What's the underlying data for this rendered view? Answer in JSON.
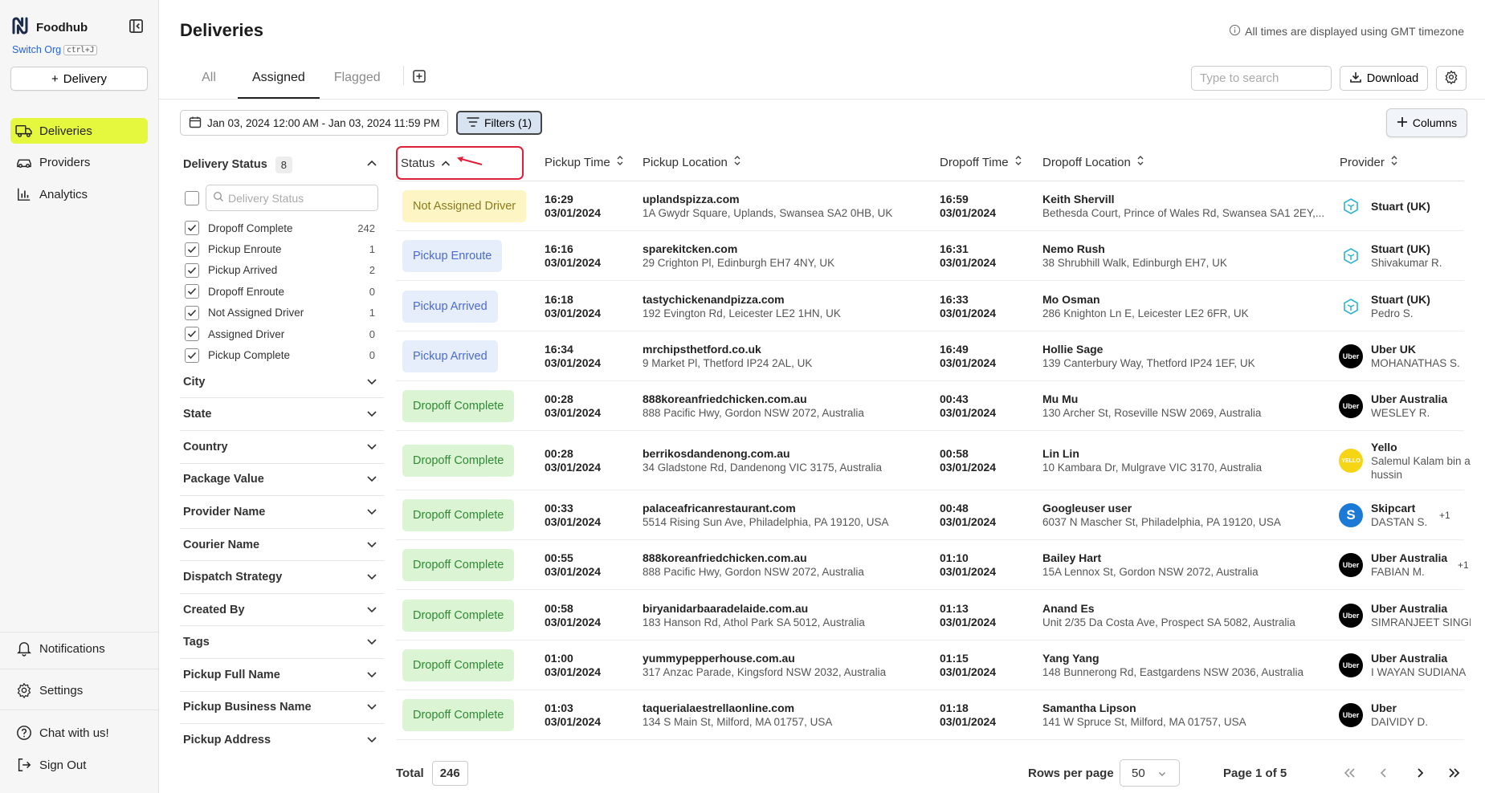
{
  "sidebar": {
    "brand": "Foodhub",
    "switch_org": "Switch Org",
    "switch_org_kbd": "ctrl+J",
    "add_delivery": "Delivery",
    "nav": [
      {
        "label": "Deliveries",
        "icon": "truck-icon",
        "active": true
      },
      {
        "label": "Providers",
        "icon": "car-icon"
      },
      {
        "label": "Analytics",
        "icon": "bar-chart-icon"
      }
    ],
    "bottom": [
      {
        "label": "Notifications",
        "icon": "bell-icon"
      },
      {
        "label": "Settings",
        "icon": "gear-icon"
      },
      {
        "label": "Chat with us!",
        "icon": "help-circle-icon"
      },
      {
        "label": "Sign Out",
        "icon": "sign-out-icon"
      }
    ]
  },
  "header": {
    "title": "Deliveries",
    "tz_note": "All times are displayed using GMT timezone",
    "tabs": [
      {
        "label": "All"
      },
      {
        "label": "Assigned",
        "active": true
      },
      {
        "label": "Flagged"
      }
    ],
    "search_placeholder": "Type to search",
    "download": "Download"
  },
  "toolbar": {
    "date_range": "Jan 03, 2024 12:00 AM - Jan 03, 2024 11:59 PM",
    "filters": "Filters (1)",
    "columns": "Columns"
  },
  "filters": {
    "delivery_status": {
      "title": "Delivery Status",
      "count": "8",
      "search_placeholder": "Delivery Status",
      "options": [
        {
          "label": "Dropoff Complete",
          "count": "242"
        },
        {
          "label": "Pickup Enroute",
          "count": "1"
        },
        {
          "label": "Pickup Arrived",
          "count": "2"
        },
        {
          "label": "Dropoff Enroute",
          "count": "0"
        },
        {
          "label": "Not Assigned Driver",
          "count": "1"
        },
        {
          "label": "Assigned Driver",
          "count": "0"
        },
        {
          "label": "Pickup Complete",
          "count": "0"
        }
      ]
    },
    "sections": [
      "City",
      "State",
      "Country",
      "Package Value",
      "Provider Name",
      "Courier Name",
      "Dispatch Strategy",
      "Created By",
      "Tags",
      "Pickup Full Name",
      "Pickup Business Name",
      "Pickup Address"
    ]
  },
  "table": {
    "columns": [
      "Status",
      "Pickup Time",
      "Pickup Location",
      "Dropoff Time",
      "Dropoff Location",
      "Provider"
    ],
    "rows": [
      {
        "status": "Not Assigned Driver",
        "kind": "nad",
        "pickup_time": "16:29",
        "pickup_date": "03/01/2024",
        "pickup_name": "uplandspizza.com",
        "pickup_addr": "1A Gwydr Square, Uplands, Swansea SA2 0HB, UK",
        "dropoff_time": "16:59",
        "dropoff_date": "03/01/2024",
        "dropoff_name": "Keith Shervill",
        "dropoff_addr": "Bethesda Court, Prince of Wales Rd, Swansea SA1 2EY,...",
        "provider": "Stuart (UK)",
        "courier": "",
        "logo": "stuart"
      },
      {
        "status": "Pickup Enroute",
        "kind": "pe",
        "pickup_time": "16:16",
        "pickup_date": "03/01/2024",
        "pickup_name": "sparekitcken.com",
        "pickup_addr": "29 Crighton Pl, Edinburgh EH7 4NY, UK",
        "dropoff_time": "16:31",
        "dropoff_date": "03/01/2024",
        "dropoff_name": "Nemo Rush",
        "dropoff_addr": "38 Shrubhill Walk, Edinburgh EH7, UK",
        "provider": "Stuart (UK)",
        "courier": "Shivakumar R.",
        "logo": "stuart"
      },
      {
        "status": "Pickup Arrived",
        "kind": "pa",
        "pickup_time": "16:18",
        "pickup_date": "03/01/2024",
        "pickup_name": "tastychickenandpizza.com",
        "pickup_addr": "192 Evington Rd, Leicester LE2 1HN, UK",
        "dropoff_time": "16:33",
        "dropoff_date": "03/01/2024",
        "dropoff_name": "Mo Osman",
        "dropoff_addr": "286 Knighton Ln E, Leicester LE2 6FR, UK",
        "provider": "Stuart (UK)",
        "courier": "Pedro S.",
        "logo": "stuart"
      },
      {
        "status": "Pickup Arrived",
        "kind": "pa",
        "pickup_time": "16:34",
        "pickup_date": "03/01/2024",
        "pickup_name": "mrchipsthetford.co.uk",
        "pickup_addr": "9 Market Pl, Thetford IP24 2AL, UK",
        "dropoff_time": "16:49",
        "dropoff_date": "03/01/2024",
        "dropoff_name": "Hollie Sage",
        "dropoff_addr": "139 Canterbury Way, Thetford IP24 1EF, UK",
        "provider": "Uber UK",
        "courier": "MOHANATHAS S.",
        "logo": "uber"
      },
      {
        "status": "Dropoff Complete",
        "kind": "dc",
        "pickup_time": "00:28",
        "pickup_date": "03/01/2024",
        "pickup_name": "888koreanfriedchicken.com.au",
        "pickup_addr": "888 Pacific Hwy, Gordon NSW 2072, Australia",
        "dropoff_time": "00:43",
        "dropoff_date": "03/01/2024",
        "dropoff_name": "Mu Mu",
        "dropoff_addr": "130 Archer St, Roseville NSW 2069, Australia",
        "provider": "Uber Australia",
        "courier": "WESLEY R.",
        "logo": "uber"
      },
      {
        "status": "Dropoff Complete",
        "kind": "dc",
        "pickup_time": "00:28",
        "pickup_date": "03/01/2024",
        "pickup_name": "berrikosdandenong.com.au",
        "pickup_addr": "34 Gladstone Rd, Dandenong VIC 3175, Australia",
        "dropoff_time": "00:58",
        "dropoff_date": "03/01/2024",
        "dropoff_name": "Lin Lin",
        "dropoff_addr": "10 Kambara Dr, Mulgrave VIC 3170, Australia",
        "provider": "Yello",
        "courier": "Salemul Kalam bin a",
        "courier2": "hussin",
        "logo": "yello"
      },
      {
        "status": "Dropoff Complete",
        "kind": "dc",
        "pickup_time": "00:33",
        "pickup_date": "03/01/2024",
        "pickup_name": "palaceafricanrestaurant.com",
        "pickup_addr": "5514 Rising Sun Ave, Philadelphia, PA 19120, USA",
        "dropoff_time": "00:48",
        "dropoff_date": "03/01/2024",
        "dropoff_name": "Googleuser user",
        "dropoff_addr": "6037 N Mascher St, Philadelphia, PA 19120, USA",
        "provider": "Skipcart",
        "courier": "DASTAN S.",
        "extra": "+1",
        "logo": "skip"
      },
      {
        "status": "Dropoff Complete",
        "kind": "dc",
        "pickup_time": "00:55",
        "pickup_date": "03/01/2024",
        "pickup_name": "888koreanfriedchicken.com.au",
        "pickup_addr": "888 Pacific Hwy, Gordon NSW 2072, Australia",
        "dropoff_time": "01:10",
        "dropoff_date": "03/01/2024",
        "dropoff_name": "Bailey Hart",
        "dropoff_addr": "15A Lennox St, Gordon NSW 2072, Australia",
        "provider": "Uber Australia",
        "courier": "FABIAN M.",
        "extra": "+1",
        "logo": "uber"
      },
      {
        "status": "Dropoff Complete",
        "kind": "dc",
        "pickup_time": "00:58",
        "pickup_date": "03/01/2024",
        "pickup_name": "biryanidarbaaradelaide.com.au",
        "pickup_addr": "183 Hanson Rd, Athol Park SA 5012, Australia",
        "dropoff_time": "01:13",
        "dropoff_date": "03/01/2024",
        "dropoff_name": "Anand Es",
        "dropoff_addr": "Unit 2/35 Da Costa Ave, Prospect SA 5082, Australia",
        "provider": "Uber Australia",
        "courier": "SIMRANJEET SINGH",
        "logo": "uber"
      },
      {
        "status": "Dropoff Complete",
        "kind": "dc",
        "pickup_time": "01:00",
        "pickup_date": "03/01/2024",
        "pickup_name": "yummypepperhouse.com.au",
        "pickup_addr": "317 Anzac Parade, Kingsford NSW 2032, Australia",
        "dropoff_time": "01:15",
        "dropoff_date": "03/01/2024",
        "dropoff_name": "Yang Yang",
        "dropoff_addr": "148 Bunnerong Rd, Eastgardens NSW 2036, Australia",
        "provider": "Uber Australia",
        "courier": "I WAYAN SUDIANA",
        "logo": "uber"
      },
      {
        "status": "Dropoff Complete",
        "kind": "dc",
        "pickup_time": "01:03",
        "pickup_date": "03/01/2024",
        "pickup_name": "taquerialaestrellaonline.com",
        "pickup_addr": "134 S Main St, Milford, MA 01757, USA",
        "dropoff_time": "01:18",
        "dropoff_date": "03/01/2024",
        "dropoff_name": "Samantha Lipson",
        "dropoff_addr": "141 W Spruce St, Milford, MA 01757, USA",
        "provider": "Uber",
        "courier": "DAIVIDY D.",
        "logo": "uber"
      }
    ]
  },
  "footer": {
    "total_label": "Total",
    "total": "246",
    "rows_per_page_label": "Rows per page",
    "rows_per_page": "50",
    "page": "Page 1 of 5"
  },
  "colors": {
    "active_nav": "#e5f83d",
    "highlight": "#e0203a",
    "dropoff_complete_bg": "#dbf5d4",
    "pickup_bg": "#e7eefb",
    "not_assigned_bg": "#fdf5c4"
  }
}
